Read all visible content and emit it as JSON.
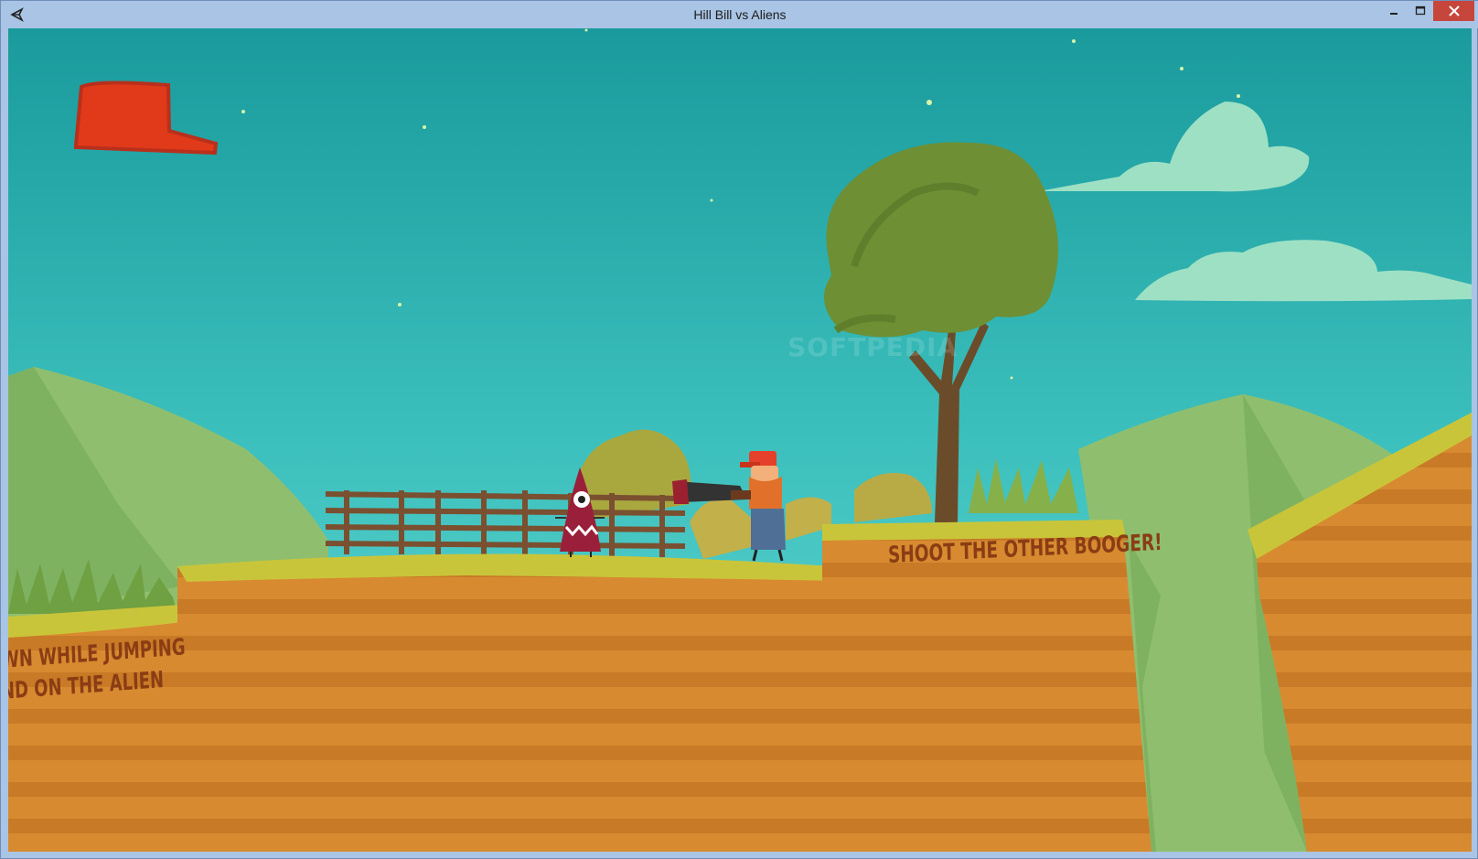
{
  "window": {
    "title": "Hill Bill vs Aliens",
    "controls": {
      "minimize": "minimize-icon",
      "maximize": "maximize-icon",
      "close": "close-icon"
    },
    "close_color": "#c7463c"
  },
  "game": {
    "hud": {
      "icon": "red-cap-icon",
      "color": "#e03a1a"
    },
    "signs": [
      "WN WHILE JUMPING",
      "ND ON THE ALIEN",
      "SHOOT THE OTHER BOOGER!"
    ],
    "watermark": "SOFTPEDIA",
    "colors": {
      "sky_top": "#1a9a9c",
      "sky_bottom": "#6ad8d4",
      "dirt": "#d88a30",
      "grass": "#c9c53a",
      "hill": "#8fbf6e",
      "tree": "#6e8f34"
    }
  }
}
